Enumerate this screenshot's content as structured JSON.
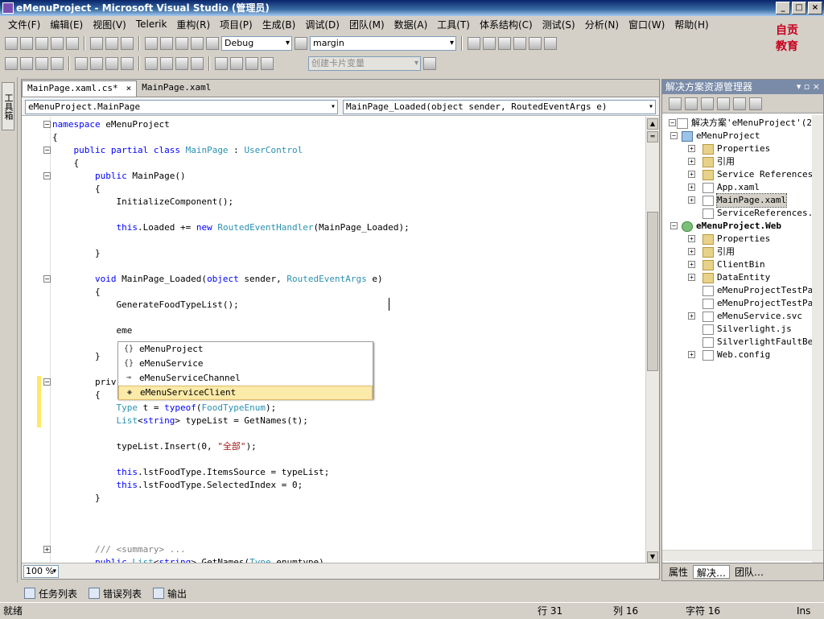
{
  "window": {
    "title": "eMenuProject - Microsoft Visual Studio (管理员)"
  },
  "menu": [
    "文件(F)",
    "编辑(E)",
    "视图(V)",
    "Telerik",
    "重构(R)",
    "项目(P)",
    "生成(B)",
    "调试(D)",
    "团队(M)",
    "数据(A)",
    "工具(T)",
    "体系结构(C)",
    "测试(S)",
    "分析(N)",
    "窗口(W)",
    "帮助(H)"
  ],
  "toolbar": {
    "config": "Debug",
    "find": "margin",
    "hint": "创建卡片变量"
  },
  "logo": {
    "line1": "自贡",
    "line2": "教育"
  },
  "toolbox": {
    "label": "工具箱"
  },
  "tabs": [
    {
      "label": "MainPage.xaml.cs*",
      "close": "×"
    },
    {
      "label": "MainPage.xaml"
    }
  ],
  "nav": {
    "class": "eMenuProject.MainPage",
    "member": "MainPage_Loaded(object sender, RoutedEventArgs e)"
  },
  "code": [
    [
      {
        "t": "namespace ",
        "c": "kw"
      },
      {
        "t": "eMenuProject"
      }
    ],
    [
      {
        "t": "{"
      }
    ],
    [
      {
        "t": "    public partial class ",
        "c": "kw"
      },
      {
        "t": "MainPage",
        "c": "ty"
      },
      {
        "t": " : "
      },
      {
        "t": "UserControl",
        "c": "ty"
      }
    ],
    [
      {
        "t": "    {"
      }
    ],
    [
      {
        "t": "        public ",
        "c": "kw"
      },
      {
        "t": "MainPage()"
      }
    ],
    [
      {
        "t": "        {"
      }
    ],
    [
      {
        "t": "            InitializeComponent();"
      }
    ],
    [
      {
        "t": ""
      }
    ],
    [
      {
        "t": "            this",
        "c": "kw"
      },
      {
        "t": ".Loaded += "
      },
      {
        "t": "new ",
        "c": "kw"
      },
      {
        "t": "RoutedEventHandler",
        "c": "ty"
      },
      {
        "t": "(MainPage_Loaded);"
      }
    ],
    [
      {
        "t": ""
      }
    ],
    [
      {
        "t": "        }"
      }
    ],
    [
      {
        "t": ""
      }
    ],
    [
      {
        "t": "        void ",
        "c": "kw"
      },
      {
        "t": "MainPage_Loaded("
      },
      {
        "t": "object ",
        "c": "kw"
      },
      {
        "t": "sender, "
      },
      {
        "t": "RoutedEventArgs",
        "c": "ty"
      },
      {
        "t": " e)"
      }
    ],
    [
      {
        "t": "        {"
      }
    ],
    [
      {
        "t": "            GenerateFoodTypeList();"
      }
    ],
    [
      {
        "t": ""
      }
    ],
    [
      {
        "t": "            eme"
      }
    ],
    [
      {
        "t": ""
      }
    ],
    [
      {
        "t": "        }"
      }
    ],
    [
      {
        "t": ""
      }
    ],
    [
      {
        "t": "        priv"
      }
    ],
    [
      {
        "t": "        {"
      }
    ],
    [
      {
        "t": "            Type",
        "c": "ty"
      },
      {
        "t": " t = "
      },
      {
        "t": "typeof",
        "c": "kw"
      },
      {
        "t": "("
      },
      {
        "t": "FoodTypeEnum",
        "c": "ty"
      },
      {
        "t": ");"
      }
    ],
    [
      {
        "t": "            List",
        "c": "ty"
      },
      {
        "t": "<"
      },
      {
        "t": "string",
        "c": "kw"
      },
      {
        "t": "> typeList = GetNames(t);"
      }
    ],
    [
      {
        "t": ""
      }
    ],
    [
      {
        "t": "            typeList.Insert(0, "
      },
      {
        "t": "\"全部\"",
        "c": "str"
      },
      {
        "t": ");"
      }
    ],
    [
      {
        "t": ""
      }
    ],
    [
      {
        "t": "            this",
        "c": "kw"
      },
      {
        "t": ".lstFoodType.ItemsSource = typeList;"
      }
    ],
    [
      {
        "t": "            this",
        "c": "kw"
      },
      {
        "t": ".lstFoodType.SelectedIndex = 0;"
      }
    ],
    [
      {
        "t": "        }"
      }
    ],
    [
      {
        "t": ""
      }
    ],
    [
      {
        "t": ""
      }
    ],
    [
      {
        "t": ""
      }
    ],
    [
      {
        "t": "        /// <summary> ...",
        "c": "cmt"
      }
    ],
    [
      {
        "t": "        public ",
        "c": "kw"
      },
      {
        "t": "List",
        "c": "ty"
      },
      {
        "t": "<"
      },
      {
        "t": "string",
        "c": "kw"
      },
      {
        "t": "> GetNames("
      },
      {
        "t": "Type",
        "c": "ty"
      },
      {
        "t": " enumtype)"
      }
    ]
  ],
  "intellisense": [
    {
      "glyph": "{}",
      "label": "eMenuProject"
    },
    {
      "glyph": "{}",
      "label": "eMenuService"
    },
    {
      "glyph": "⊸",
      "label": "eMenuServiceChannel"
    },
    {
      "glyph": "◈",
      "label": "eMenuServiceClient",
      "selected": true
    }
  ],
  "zoom": "100 %",
  "solution_explorer": {
    "title": "解决方案资源管理器",
    "pin": "▾ ▫ ×",
    "tree": [
      {
        "label": "解决方案'eMenuProject'(2",
        "depth": 0,
        "icon": "file",
        "exp": "−"
      },
      {
        "label": "eMenuProject",
        "depth": 1,
        "icon": "proj",
        "exp": "−"
      },
      {
        "label": "Properties",
        "depth": 2,
        "icon": "folder",
        "exp": "+"
      },
      {
        "label": "引用",
        "depth": 2,
        "icon": "folder",
        "exp": "+"
      },
      {
        "label": "Service References",
        "depth": 2,
        "icon": "folder",
        "exp": "+"
      },
      {
        "label": "App.xaml",
        "depth": 2,
        "icon": "file",
        "exp": "+"
      },
      {
        "label": "MainPage.xaml",
        "depth": 2,
        "icon": "file",
        "exp": "+",
        "selected": true
      },
      {
        "label": "ServiceReferences.Cli",
        "depth": 2,
        "icon": "file"
      },
      {
        "label": "eMenuProject.Web",
        "depth": 1,
        "icon": "web",
        "exp": "−",
        "bold": true
      },
      {
        "label": "Properties",
        "depth": 2,
        "icon": "folder",
        "exp": "+"
      },
      {
        "label": "引用",
        "depth": 2,
        "icon": "folder",
        "exp": "+"
      },
      {
        "label": "ClientBin",
        "depth": 2,
        "icon": "folder",
        "exp": "+"
      },
      {
        "label": "DataEntity",
        "depth": 2,
        "icon": "folder",
        "exp": "+"
      },
      {
        "label": "eMenuProjectTestPage.",
        "depth": 2,
        "icon": "file"
      },
      {
        "label": "eMenuProjectTestPage.",
        "depth": 2,
        "icon": "file"
      },
      {
        "label": "eMenuService.svc",
        "depth": 2,
        "icon": "file",
        "exp": "+"
      },
      {
        "label": "Silverlight.js",
        "depth": 2,
        "icon": "file"
      },
      {
        "label": "SilverlightFaultBehav",
        "depth": 2,
        "icon": "file"
      },
      {
        "label": "Web.config",
        "depth": 2,
        "icon": "file",
        "exp": "+"
      }
    ],
    "tabs": [
      "属性",
      "解决…",
      "团队…"
    ]
  },
  "bottom_tabs": [
    "任务列表",
    "错误列表",
    "输出"
  ],
  "status": {
    "ready": "就绪",
    "line": "行 31",
    "col": "列 16",
    "ch": "字符 16",
    "mode": "Ins"
  }
}
